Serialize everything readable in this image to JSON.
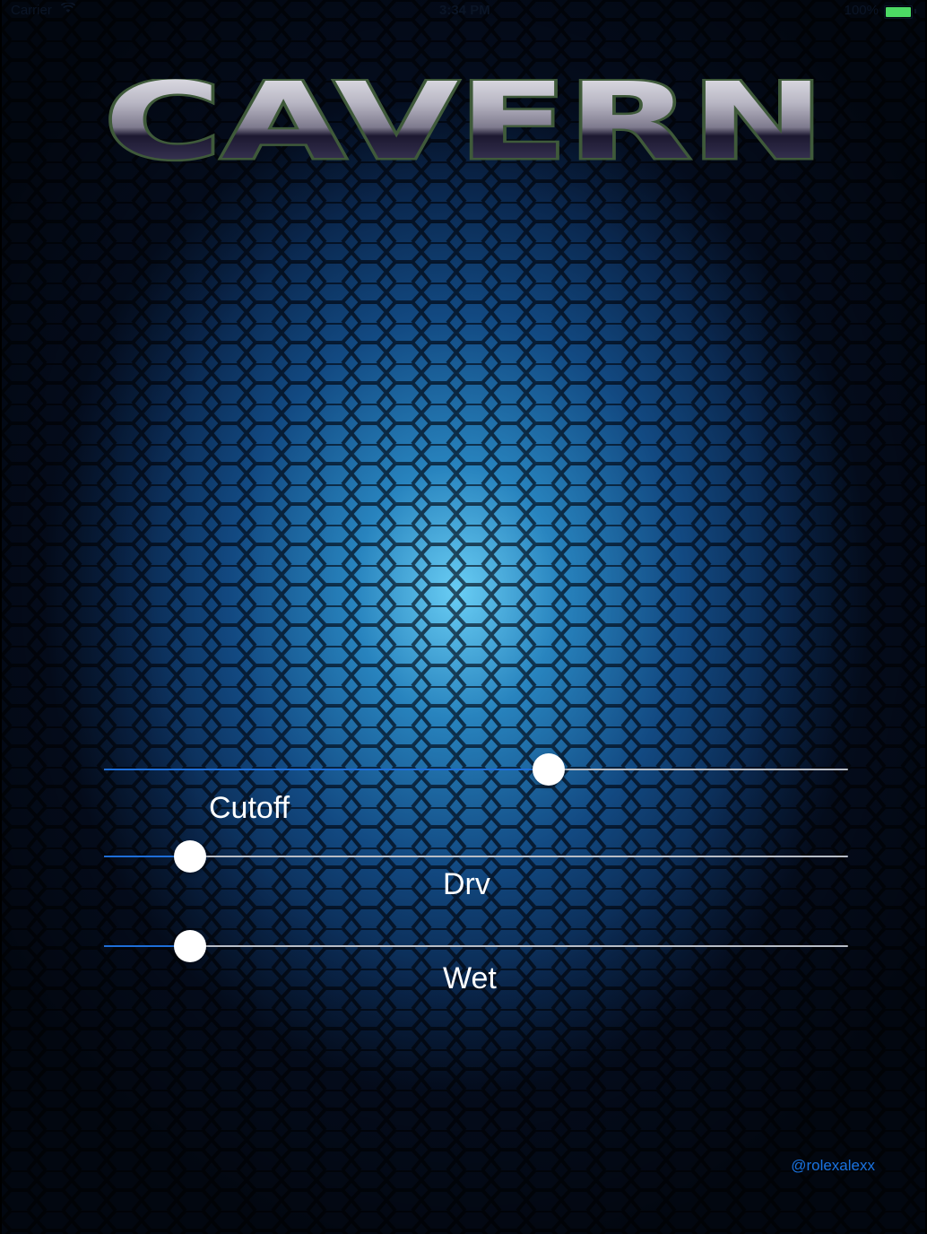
{
  "status_bar": {
    "carrier": "Carrier",
    "wifi_icon": "wifi-icon",
    "time": "3:34 PM",
    "battery_pct": "100%",
    "battery_level": 1.0,
    "battery_color": "#4cd964"
  },
  "logo": {
    "text": "CAVERN"
  },
  "sliders": [
    {
      "name": "cutoff",
      "label": "Cutoff",
      "value": 0.598
    },
    {
      "name": "drv",
      "label": "Drv",
      "value": 0.116
    },
    {
      "name": "wet",
      "label": "Wet",
      "value": 0.116
    }
  ],
  "footer": {
    "handle": "@rolexalexx"
  },
  "colors": {
    "accent": "#1e6ed8",
    "track": "#b8bdc6",
    "link": "#1a73e0"
  }
}
